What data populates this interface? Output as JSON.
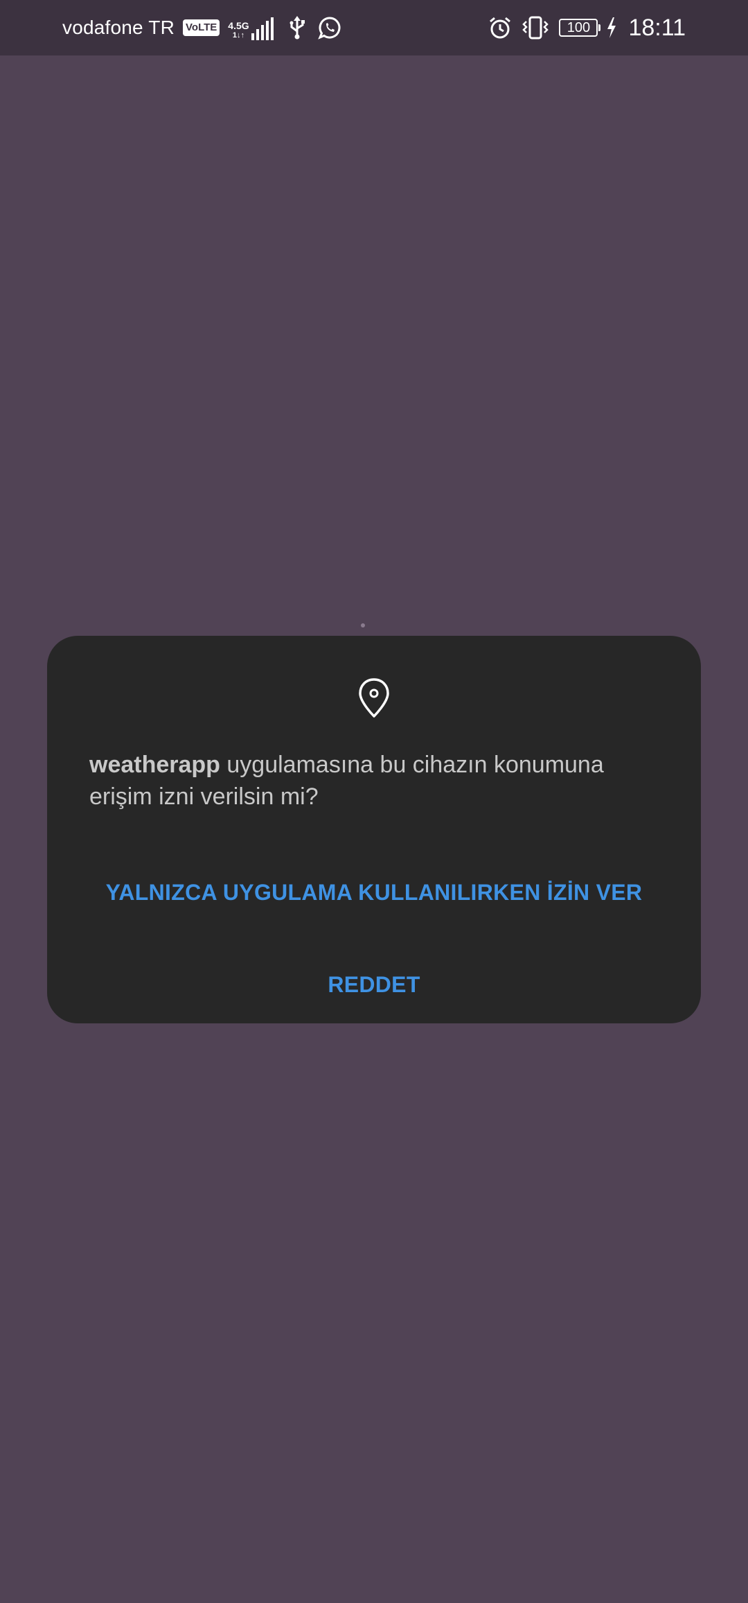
{
  "status_bar": {
    "carrier": "vodafone TR",
    "volte": "VoLTE",
    "network_type": "4.5G",
    "network_sub": "1↓↑",
    "battery": "100",
    "time": "18:11",
    "icons": [
      "signal-icon",
      "usb-icon",
      "whatsapp-icon",
      "alarm-icon",
      "vibrate-icon",
      "battery-icon",
      "charging-icon"
    ]
  },
  "dialog": {
    "icon": "location-pin-icon",
    "app_name": "weatherapp",
    "message": " uygulamasına bu cihazın konumuna erişim izni verilsin mi?",
    "allow_label": "YALNIZCA UYGULAMA KULLANILIRKEN İZİN VER",
    "deny_label": "REDDET"
  },
  "colors": {
    "background": "#514355",
    "status_bar": "#3c3240",
    "dialog": "#272727",
    "accent": "#3f92e3",
    "text": "#c9c9c9"
  }
}
